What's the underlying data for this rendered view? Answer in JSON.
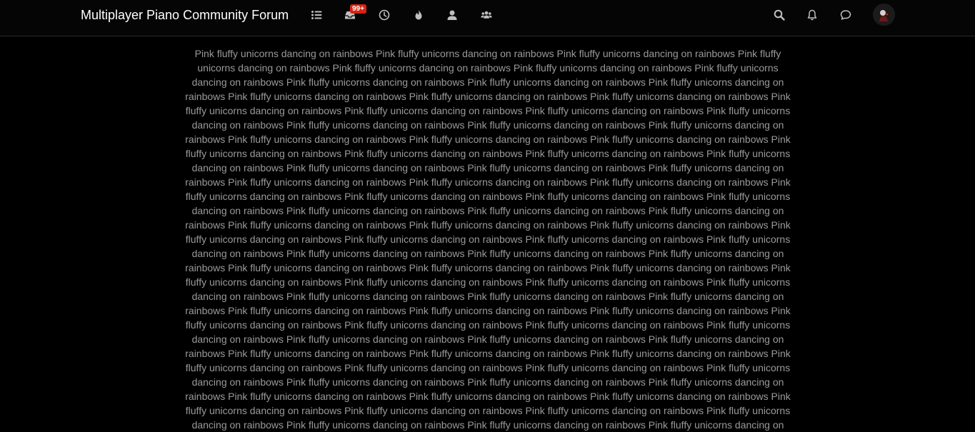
{
  "header": {
    "title": "Multiplayer Piano Community Forum",
    "inbox_badge": "99+"
  },
  "nav": {
    "icons": [
      "list-icon",
      "inbox-icon",
      "clock-icon",
      "fire-icon",
      "user-icon",
      "users-icon"
    ],
    "right_icons": [
      "search-icon",
      "bell-icon",
      "comment-icon"
    ]
  },
  "colors": {
    "background": "#000000",
    "topbar": "#050505",
    "icon": "#bfbfbf",
    "badge": "#d9230f",
    "text": "#9a9a9a"
  },
  "post": {
    "phrase": "Pink fluffy unicorns dancing on rainbows",
    "repeat": 90
  }
}
